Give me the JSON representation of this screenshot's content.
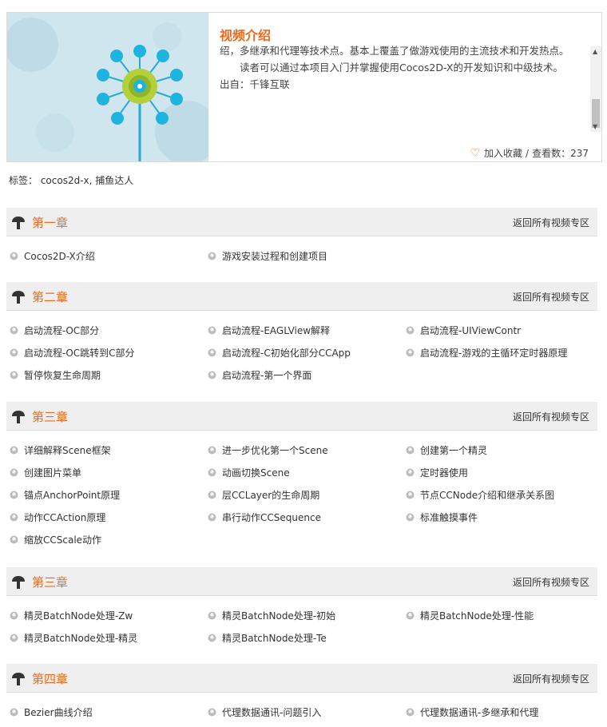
{
  "intro": {
    "title": "视频介绍",
    "paragraphs": [
      "绍，多继承和代理等技术点。基本上覆盖了做游戏使用的主流技术和开发热点。",
      "读者可以通过本项目入门并掌握使用Cocos2D-X的开发知识和中级技术。",
      "出自：千锋互联"
    ],
    "favorite_label": "加入收藏",
    "separator": "/",
    "views_label": "查看数：237",
    "scroll_up": "▲",
    "scroll_down": "▼"
  },
  "tags": "标签： cocos2d-x, 捕鱼达人",
  "colors": {
    "accent": "#f06a1e",
    "header_bg": "#efefef",
    "thumb_bg": "#cfe6ee"
  },
  "icons": {
    "chapter": "mushroom-icon",
    "lesson": "bullet-dot-icon",
    "favorite": "heart-icon"
  },
  "chapters": [
    {
      "title": "第一章",
      "back": "返回所有视频专区",
      "lessons": [
        "Cocos2D-X介绍",
        "游戏安装过程和创建项目"
      ]
    },
    {
      "title": "第二章",
      "back": "返回所有视频专区",
      "lessons": [
        "启动流程-OC部分",
        "启动流程-EAGLView解释",
        "启动流程-UIViewContr",
        "启动流程-OC跳转到C部分",
        "启动流程-C初始化部分CCApp",
        "启动流程-游戏的主循环定时器原理",
        "暂停恢复生命周期",
        "启动流程-第一个界面"
      ]
    },
    {
      "title": "第三章",
      "back": "返回所有视频专区",
      "lessons": [
        "详细解释Scene框架",
        "进一步优化第一个Scene",
        "创建第一个精灵",
        "创建图片菜单",
        "动画切换Scene",
        "定时器使用",
        "锚点AnchorPoint原理",
        "层CCLayer的生命周期",
        "节点CCNode介绍和继承关系图",
        "动作CCAction原理",
        "串行动作CCSequence",
        "标准触摸事件",
        "缩放CCScale动作"
      ]
    },
    {
      "title": "第三章",
      "back": "返回所有视频专区",
      "lessons": [
        "精灵BatchNode处理-Zw",
        "精灵BatchNode处理-初始",
        "精灵BatchNode处理-性能",
        "精灵BatchNode处理-精灵",
        "精灵BatchNode处理-Te"
      ]
    },
    {
      "title": "第四章",
      "back": "返回所有视频专区",
      "lessons": [
        "Bezier曲线介绍",
        "代理数据通讯-问题引入",
        "代理数据通讯-多继承和代理"
      ]
    }
  ]
}
